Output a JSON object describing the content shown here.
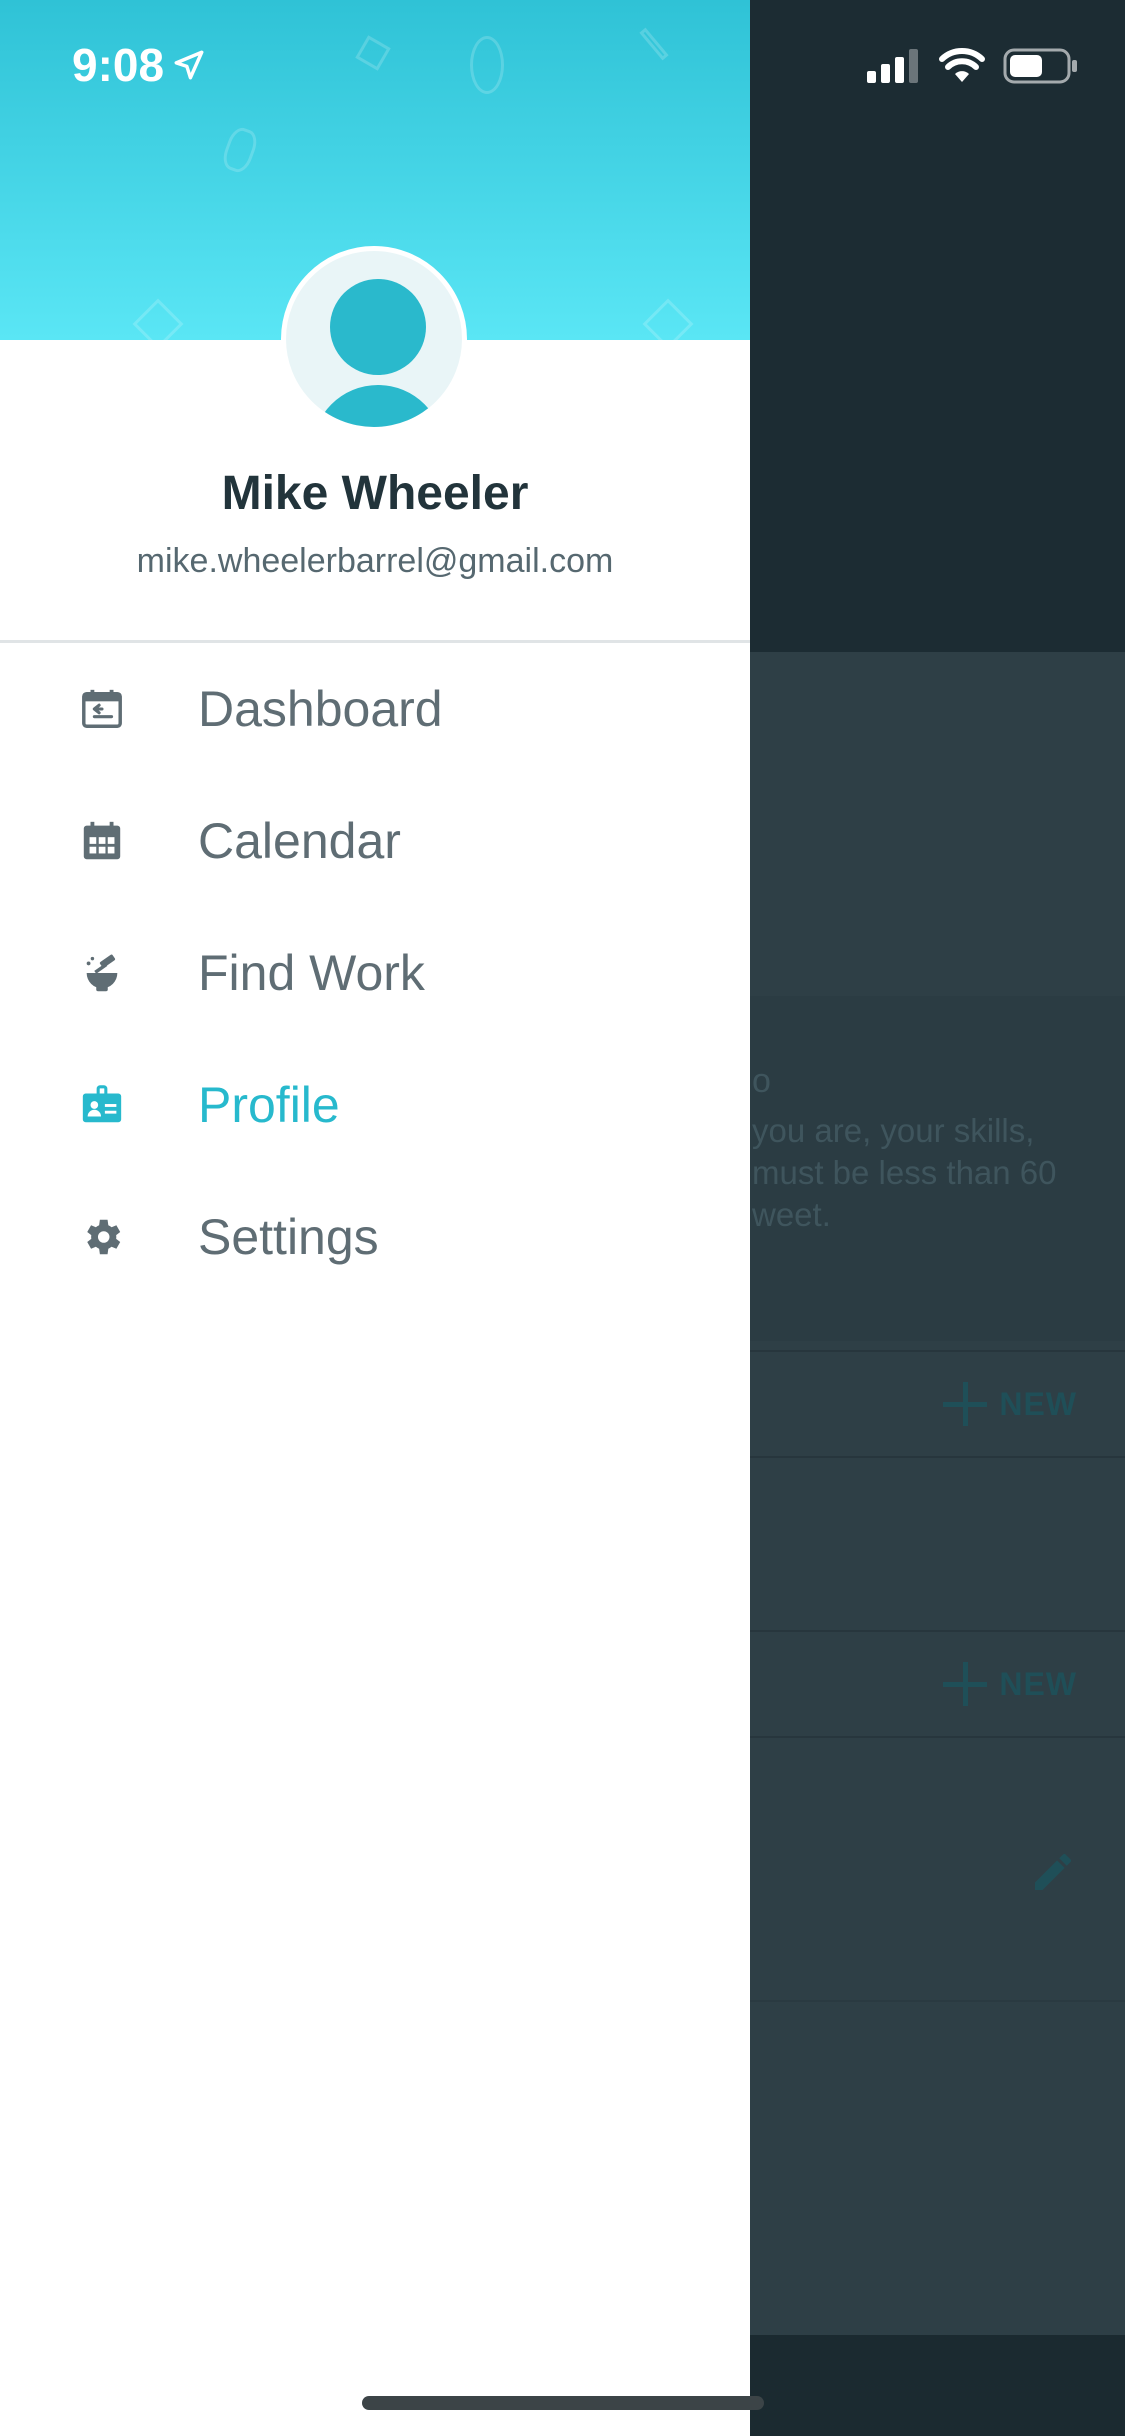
{
  "status_bar": {
    "time": "9:08"
  },
  "drawer": {
    "user": {
      "name": "Mike Wheeler",
      "email": "mike.wheelerbarrel@gmail.com"
    },
    "menu": [
      {
        "label": "Dashboard",
        "icon": "calendar-arrow-icon",
        "active": false
      },
      {
        "label": "Calendar",
        "icon": "calendar-grid-icon",
        "active": false
      },
      {
        "label": "Find Work",
        "icon": "find-work-icon",
        "active": false
      },
      {
        "label": "Profile",
        "icon": "id-badge-icon",
        "active": true
      },
      {
        "label": "Settings",
        "icon": "gear-icon",
        "active": false
      }
    ],
    "accent_color": "#27b9cd",
    "text_color": "#5f6d74"
  },
  "background_app": {
    "section_title_fragment": "o",
    "description_fragment": "you are, your skills, must be less than 60 weet.",
    "new_label": "NEW"
  }
}
